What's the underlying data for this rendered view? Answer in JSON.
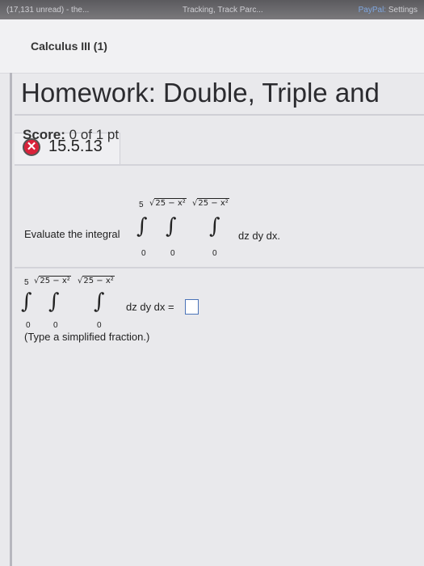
{
  "browser": {
    "tab1": "(17,131 unread) - the...",
    "tab2": "Tracking, Track Parc...",
    "tab3_brand": "PayPal:",
    "tab3_rest": " Settings"
  },
  "course": {
    "title": "Calculus III (1)"
  },
  "homework": {
    "title": "Homework: Double, Triple and"
  },
  "score": {
    "label": "Score:",
    "value": "0 of 1 pt"
  },
  "question": {
    "number": "15.5.13",
    "status_icon": "x-icon",
    "prompt": "Evaluate the integral",
    "integrand": "dz dy dx.",
    "limits": {
      "outer_upper": "5",
      "middle_upper": "25 − x²",
      "inner_upper": "25 − x²",
      "outer_lower": "0",
      "middle_lower": "0",
      "inner_lower": "0"
    },
    "answer_integrand": "dz dy dx =",
    "answer_value": "",
    "hint": "(Type a simplified fraction.)"
  },
  "colors": {
    "error_red": "#d9223a",
    "answer_border": "#4a73b8"
  }
}
